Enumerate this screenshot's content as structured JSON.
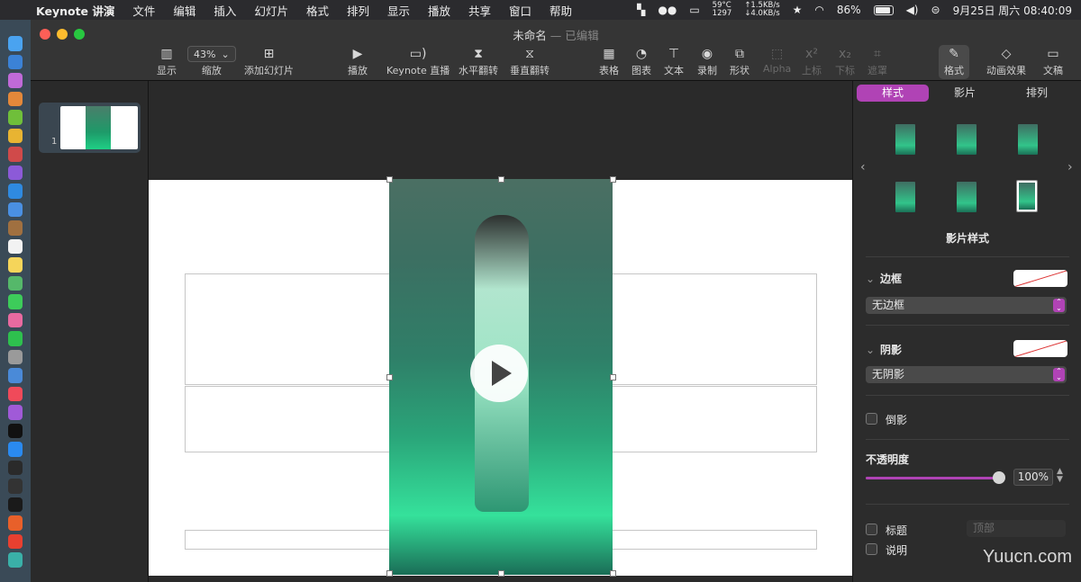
{
  "menubar": {
    "app": "Keynote 讲演",
    "items": [
      "文件",
      "编辑",
      "插入",
      "幻灯片",
      "格式",
      "排列",
      "显示",
      "播放",
      "共享",
      "窗口",
      "帮助"
    ],
    "temp_line1": "59°C",
    "temp_line2": "1297",
    "net_up": "↑1.5KB/s",
    "net_down": "↓4.0KB/s",
    "battery": "86%",
    "datetime": "9月25日 周六  08:40:09"
  },
  "window": {
    "title": "未命名",
    "title_sub": "— 已编辑"
  },
  "toolbar": {
    "view_label": "显示",
    "zoom_value": "43%",
    "zoom_label": "缩放",
    "add_slide_label": "添加幻灯片",
    "play_label": "播放",
    "keynote_live_label": "Keynote 直播",
    "flip_h_label": "水平翻转",
    "flip_v_label": "垂直翻转",
    "table_label": "表格",
    "chart_label": "图表",
    "text_label": "文本",
    "record_label": "录制",
    "shape_label": "形状",
    "alpha_label": "Alpha",
    "superscript_label": "上标",
    "subscript_label": "下标",
    "mask_label": "遮罩",
    "format_label": "格式",
    "animate_label": "动画效果",
    "document_label": "文稿"
  },
  "navigator": {
    "slide_number": "1"
  },
  "inspector": {
    "tabs": [
      "样式",
      "影片",
      "排列"
    ],
    "styles_title": "影片样式",
    "border_label": "边框",
    "border_value": "无边框",
    "shadow_label": "阴影",
    "shadow_value": "无阴影",
    "reflection_label": "倒影",
    "opacity_label": "不透明度",
    "opacity_value": "100%",
    "opacity_fraction": 1.0,
    "title_label": "标题",
    "title_position_value": "顶部",
    "caption_label": "说明"
  },
  "watermark": "Yuucn.com"
}
